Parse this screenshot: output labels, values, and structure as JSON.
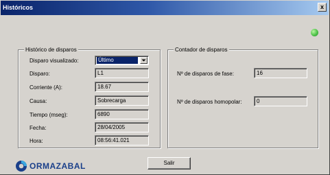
{
  "window": {
    "title": "Históricos",
    "close_label": "x"
  },
  "indicator": {
    "color": "#4ec24a"
  },
  "history_group": {
    "title": "Histórico de disparos",
    "fields": {
      "disparo_visualizado": {
        "label": "Disparo visualizado:",
        "value": "Último"
      },
      "disparo": {
        "label": "Disparo:",
        "value": "L1"
      },
      "corriente": {
        "label": "Corriente (A):",
        "value": "18.67"
      },
      "causa": {
        "label": "Causa:",
        "value": "Sobrecarga"
      },
      "tiempo": {
        "label": "Tiempo (mseg):",
        "value": "6890"
      },
      "fecha": {
        "label": "Fecha:",
        "value": "28/04/2005"
      },
      "hora": {
        "label": "Hora:",
        "value": "08:56:41.021"
      }
    }
  },
  "counter_group": {
    "title": "Contador de disparos",
    "fields": {
      "fase": {
        "label": "Nº de disparos de fase:",
        "value": "16"
      },
      "homopolar": {
        "label": "Nº de disparos homopolar:",
        "value": "0"
      }
    }
  },
  "logo": {
    "text": "ORMAZABAL"
  },
  "buttons": {
    "exit_label": "Salir"
  }
}
